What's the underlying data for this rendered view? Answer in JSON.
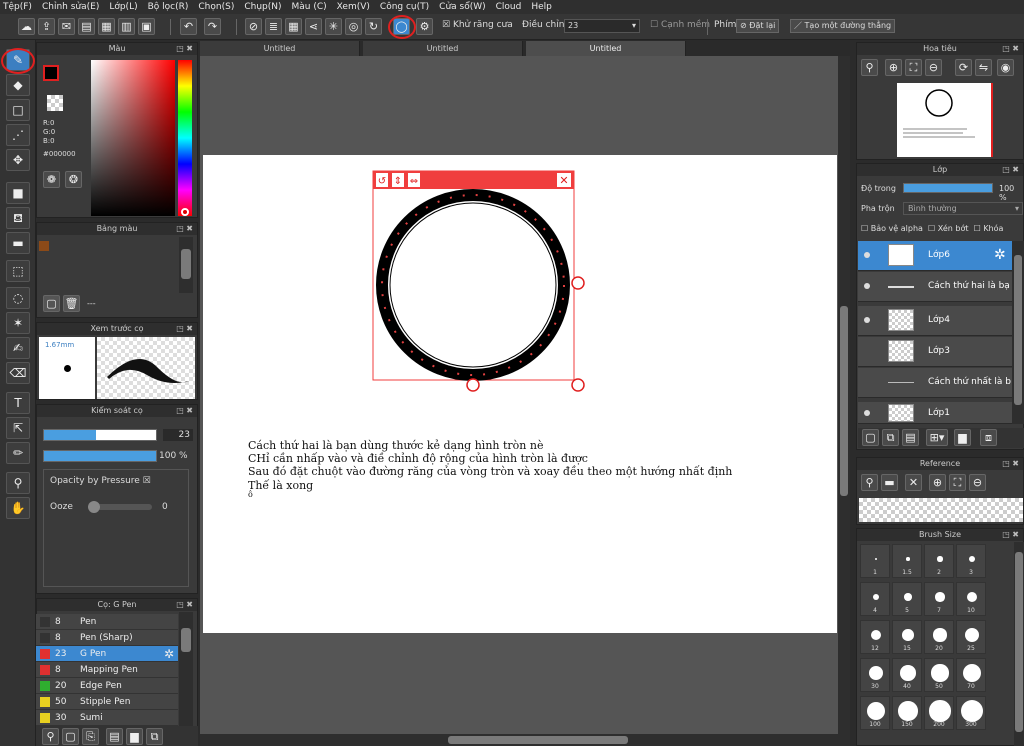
{
  "menu": [
    "Tệp(F)",
    "Chỉnh sửa(E)",
    "Lớp(L)",
    "Bộ lọc(R)",
    "Chọn(S)",
    "Chụp(N)",
    "Màu (C)",
    "Xem(V)",
    "Công cụ(T)",
    "Cửa sổ(W)",
    "Cloud",
    "Help"
  ],
  "toolbar": {
    "antialias_label": "Khử răng cưa",
    "adjust_label": "Điều chỉnh",
    "adjust_value": "23",
    "soft_edge_label": "Cạnh mềm",
    "key_label": "Phím",
    "reset_label": "Đặt lại",
    "line_label": "Tạo một đường thẳng"
  },
  "color_panel": {
    "title": "Màu",
    "r": "R:0",
    "g": "G:0",
    "b": "B:0",
    "hex": "#000000"
  },
  "palette_panel": {
    "title": "Bảng màu",
    "dash": "---"
  },
  "brush_preview": {
    "title": "Xem trước cọ",
    "size": "1.67mm"
  },
  "brush_control": {
    "title": "Kiểm soát cọ",
    "size_value": "23",
    "opacity_value": "100 %",
    "opacity_pressure": "Opacity by Pressure",
    "ooze_label": "Ooze",
    "ooze_value": "0"
  },
  "brush_list": {
    "title": "Cọ: G Pen",
    "items": [
      {
        "size": "8",
        "name": "Pen",
        "color": "#333333"
      },
      {
        "size": "8",
        "name": "Pen (Sharp)",
        "color": "#333333"
      },
      {
        "size": "23",
        "name": "G Pen",
        "color": "#e03030"
      },
      {
        "size": "8",
        "name": "Mapping Pen",
        "color": "#e03030"
      },
      {
        "size": "20",
        "name": "Edge Pen",
        "color": "#2fae2f"
      },
      {
        "size": "50",
        "name": "Stipple Pen",
        "color": "#e8d020"
      },
      {
        "size": "30",
        "name": "Sumi",
        "color": "#e8d020"
      }
    ]
  },
  "tabs": [
    "Untitled",
    "Untitled",
    "Untitled"
  ],
  "canvas_text": [
    "Cách thứ hai là bạn dùng thước kẻ dạng hình tròn nè",
    "CHỉ cần nhấp vào và điề chỉnh độ rộng của hình tròn là được",
    "Sau đó đặt chuột vào đường răng của vòng tròn và xoay đều theo một hướng nhất định",
    "Thế là xong",
    "ô"
  ],
  "navigator": {
    "title": "Hoa tiêu"
  },
  "layer_panel": {
    "title": "Lớp",
    "opacity_label": "Độ trong",
    "opacity_value": "100 %",
    "blend_label": "Pha trộn",
    "blend_value": "Bình thường",
    "protect_alpha": "Bảo vệ alpha",
    "clip": "Xén bớt",
    "lock": "Khóa",
    "layers": [
      "Lớp6",
      "Cách thứ hai là bạ",
      "Lớp4",
      "Lớp3",
      "Cách thứ nhất là b",
      "Lớp1"
    ]
  },
  "reference": {
    "title": "Reference"
  },
  "brush_size": {
    "title": "Brush Size",
    "sizes": [
      "1",
      "1.5",
      "2",
      "3",
      "4",
      "5",
      "7",
      "10",
      "12",
      "15",
      "20",
      "25",
      "30",
      "40",
      "50",
      "70",
      "100",
      "150",
      "200",
      "300"
    ]
  }
}
